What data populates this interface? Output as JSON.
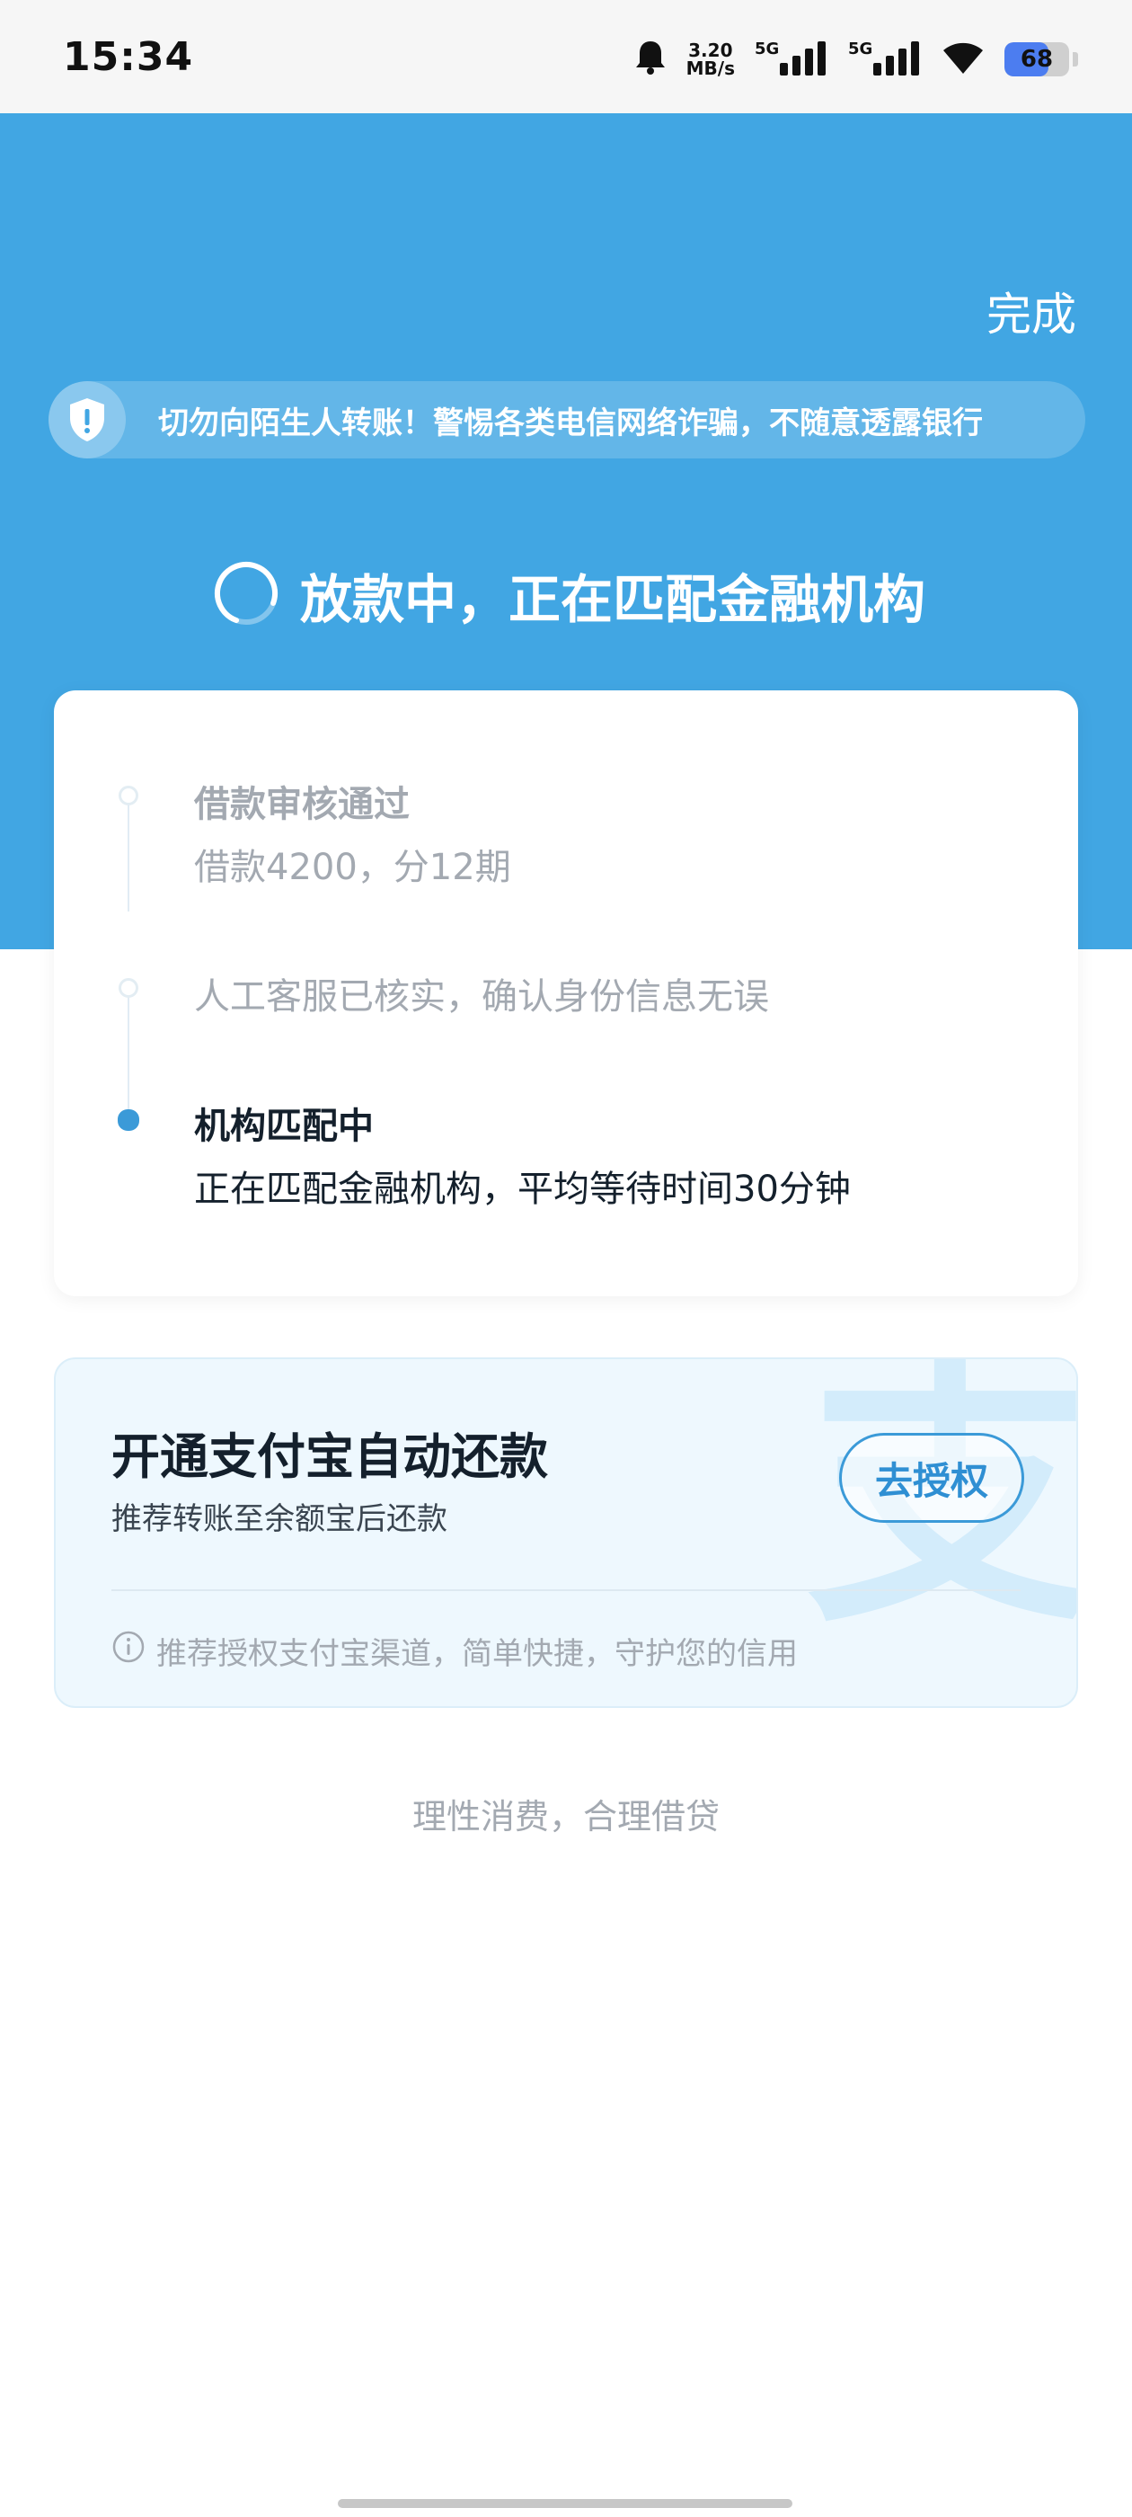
{
  "status_bar": {
    "time": "15:34",
    "net_speed_value": "3.20",
    "net_speed_unit": "MB/s",
    "signal_1_label": "5G",
    "signal_2_label": "5G",
    "battery_level": "68",
    "icons": [
      "bell-icon",
      "signal-icon",
      "wifi-icon",
      "battery-icon"
    ]
  },
  "header": {
    "done_label": "完成",
    "warning_text": "切勿向陌生人转账！警惕各类电信网络诈骗，不随意透露银行",
    "status_title": "放款中，正在匹配金融机构",
    "accent_color": "#41a6e3"
  },
  "timeline": [
    {
      "title": "借款审核通过",
      "desc": "借款4200，分12期",
      "state": "done"
    },
    {
      "title": "",
      "desc": "人工客服已核实，确认身份信息无误",
      "state": "done"
    },
    {
      "title": "机构匹配中",
      "desc": "正在匹配金融机构，平均等待时间30分钟",
      "state": "active"
    }
  ],
  "alipay": {
    "title": "开通支付宝自动还款",
    "subtitle": "推荐转账至余额宝后还款",
    "authorize_label": "去授权",
    "tip": "推荐授权支付宝渠道，简单快捷，守护您的信用"
  },
  "footer": {
    "slogan": "理性消费，合理借贷"
  }
}
